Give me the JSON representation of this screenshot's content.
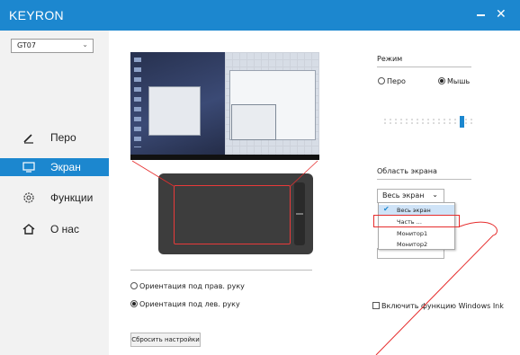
{
  "app": {
    "title": "KEYRON"
  },
  "window": {
    "minimize_icon": "minimize-icon",
    "close_icon": "close-icon",
    "close_glyph": "✕"
  },
  "device": {
    "selected": "GT07"
  },
  "nav": {
    "items": [
      {
        "label": "Перо",
        "icon": "pen-icon",
        "active": false
      },
      {
        "label": "Экран",
        "icon": "monitor-icon",
        "active": true
      },
      {
        "label": "Функции",
        "icon": "gear-icon",
        "active": false
      },
      {
        "label": "О нас",
        "icon": "home-icon",
        "active": false
      }
    ]
  },
  "mode": {
    "title": "Режим",
    "options": [
      {
        "label": "Перо",
        "selected": false
      },
      {
        "label": "Мышь",
        "selected": true
      }
    ]
  },
  "screen_area": {
    "title": "Область экрана",
    "selected": "Весь экран",
    "options": [
      {
        "label": "Весь экран",
        "selected": true
      },
      {
        "label": "Часть ...",
        "selected": false
      },
      {
        "label": "Монитор1",
        "selected": false
      },
      {
        "label": "Монитор2",
        "selected": false
      }
    ]
  },
  "orientation": {
    "options": [
      {
        "label": "Ориентация под прав. руку",
        "selected": false
      },
      {
        "label": "Ориентация под лев. руку",
        "selected": true
      }
    ]
  },
  "windows_ink": {
    "label": "Включить функцию Windows Ink",
    "checked": false
  },
  "reset_button": {
    "label": "Сбросить настройки"
  },
  "colors": {
    "accent": "#1c87cf",
    "annotation": "#e62d2d",
    "tablet": "#3d3d3d"
  }
}
